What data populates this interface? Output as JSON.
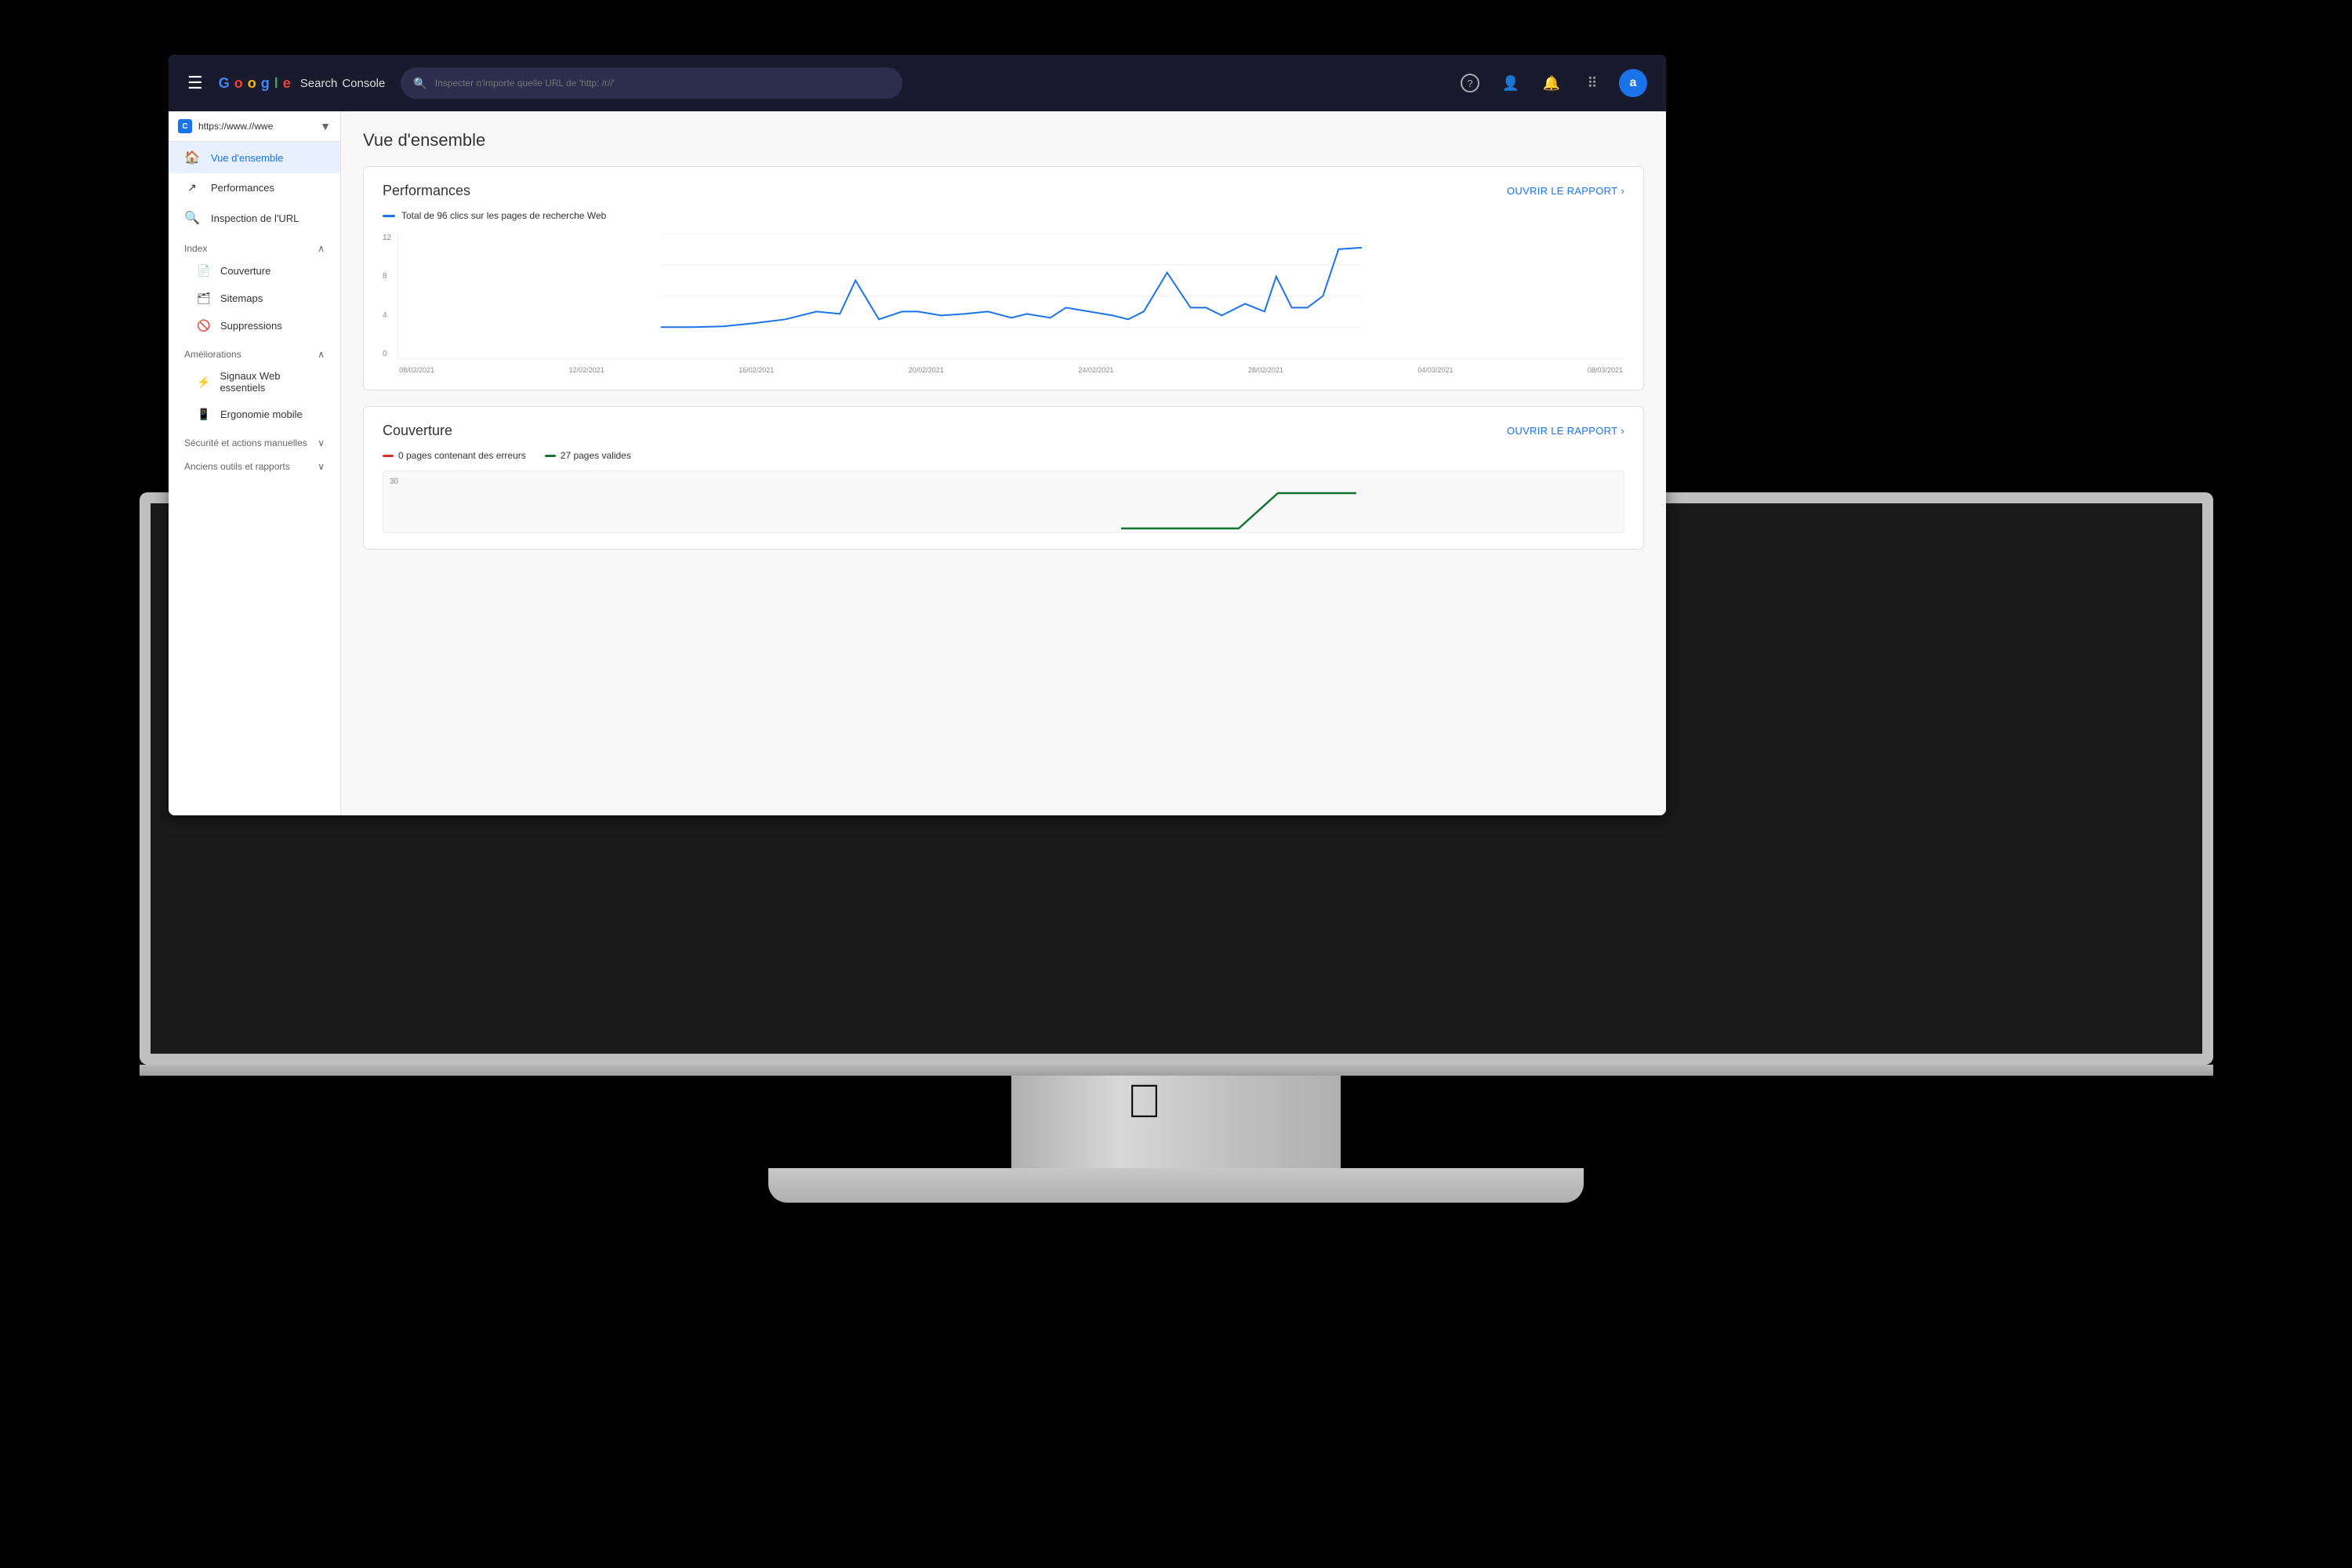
{
  "topbar": {
    "menu_icon": "☰",
    "logo": {
      "google": "Google",
      "search": "Search",
      "console": "Console"
    },
    "search_placeholder": "Inspecter n'importe quelle URL de 'http: /r//'",
    "icons": {
      "help": "?",
      "accounts": "👤",
      "bell": "🔔",
      "grid": "⠿",
      "avatar": "a"
    }
  },
  "sidebar": {
    "url": "https://www.//wwe",
    "nav_items": [
      {
        "id": "vue-ensemble",
        "label": "Vue d'ensemble",
        "icon": "🏠",
        "active": true
      },
      {
        "id": "performances",
        "label": "Performances",
        "icon": "↗"
      },
      {
        "id": "inspection-url",
        "label": "Inspection de l'URL",
        "icon": "🔍"
      }
    ],
    "sections": [
      {
        "id": "index",
        "label": "Index",
        "expanded": true,
        "items": [
          {
            "id": "couverture",
            "label": "Couverture",
            "icon": "📄"
          },
          {
            "id": "sitemaps",
            "label": "Sitemaps",
            "icon": "🗂"
          },
          {
            "id": "suppressions",
            "label": "Suppressions",
            "icon": "🚫"
          }
        ]
      },
      {
        "id": "ameliorations",
        "label": "Améliorations",
        "expanded": true,
        "items": [
          {
            "id": "signaux-web",
            "label": "Signaux Web essentiels",
            "icon": "⚡"
          },
          {
            "id": "ergonomie",
            "label": "Ergonomie mobile",
            "icon": "📱"
          }
        ]
      },
      {
        "id": "securite",
        "label": "Sécurité et actions manuelles",
        "expanded": false,
        "items": []
      },
      {
        "id": "anciens-outils",
        "label": "Anciens outils et rapports",
        "expanded": false,
        "items": []
      }
    ]
  },
  "main": {
    "page_title": "Vue d'ensemble",
    "cards": [
      {
        "id": "performances-card",
        "title": "Performances",
        "link_label": "OUVRIR LE RAPPORT",
        "legend_color": "#1a73e8",
        "legend_text": "Total de 96 clics sur les pages de recherche Web",
        "chart": {
          "y_labels": [
            "12",
            "8",
            "4",
            "0"
          ],
          "x_labels": [
            "08/02/2021",
            "12/02/2021",
            "16/02/2021",
            "20/02/2021",
            "24/02/2021",
            "28/02/2021",
            "04/03/2021",
            "08/03/2021"
          ]
        }
      },
      {
        "id": "couverture-card",
        "title": "Couverture",
        "link_label": "OUVRIR LE RAPPORT",
        "legends": [
          {
            "color": "#d93025",
            "text": "0 pages contenant des erreurs"
          },
          {
            "color": "#137333",
            "text": "27 pages valides"
          }
        ],
        "y_label": "30"
      }
    ]
  }
}
